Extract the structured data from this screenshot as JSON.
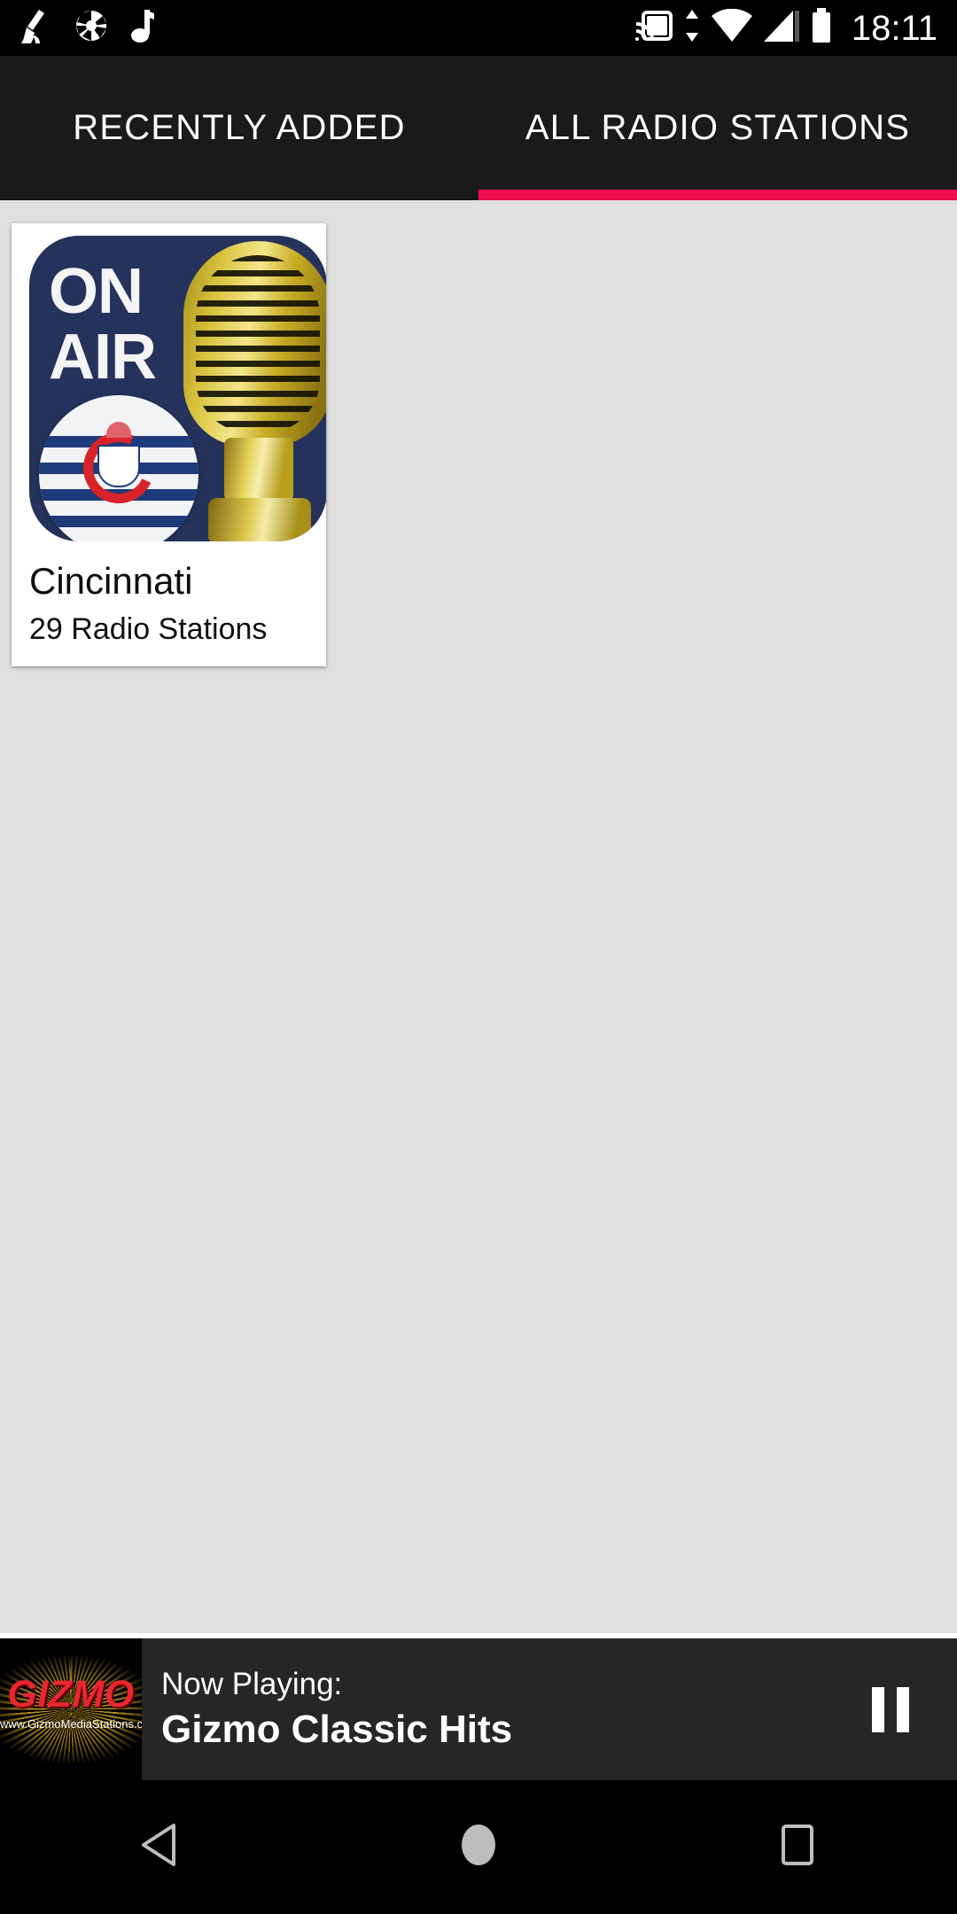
{
  "status_bar": {
    "time": "18:11",
    "left_icons": [
      {
        "name": "broom-clean-icon"
      },
      {
        "name": "camera-aperture-icon"
      },
      {
        "name": "music-note-icon"
      }
    ],
    "right_icons": [
      {
        "name": "cast-icon"
      },
      {
        "name": "data-transfer-icon"
      },
      {
        "name": "wifi-icon"
      },
      {
        "name": "cellular-signal-icon"
      },
      {
        "name": "battery-icon"
      }
    ],
    "background_color": "#000000"
  },
  "tabs": {
    "active_index": 1,
    "indicator_color": "#ee0d51",
    "background_color": "#1a1a1a",
    "items": [
      {
        "label": "RECENTLY ADDED"
      },
      {
        "label": "ALL RADIO STATIONS"
      }
    ]
  },
  "content": {
    "background_color": "#e0e0e0",
    "cards": [
      {
        "title": "Cincinnati",
        "subtitle": "29 Radio Stations",
        "artwork": {
          "name": "on-air-microphone-artwork",
          "overlay_text_line1": "ON",
          "overlay_text_line2": "AIR",
          "background_color": "#24325c"
        }
      }
    ]
  },
  "player": {
    "background_color": "#262626",
    "now_playing_label": "Now Playing:",
    "station_name": "Gizmo Classic Hits",
    "artwork": {
      "name": "gizmo-logo-artwork",
      "brand": "GIZMO",
      "url": "www.GizmoMediaStations.com",
      "brand_color": "#e8272f"
    },
    "control": {
      "name": "pause-button",
      "label": "Pause"
    }
  },
  "nav_bar": {
    "background_color": "#000000",
    "buttons": [
      {
        "name": "nav-back-button"
      },
      {
        "name": "nav-home-button"
      },
      {
        "name": "nav-recents-button"
      }
    ]
  }
}
